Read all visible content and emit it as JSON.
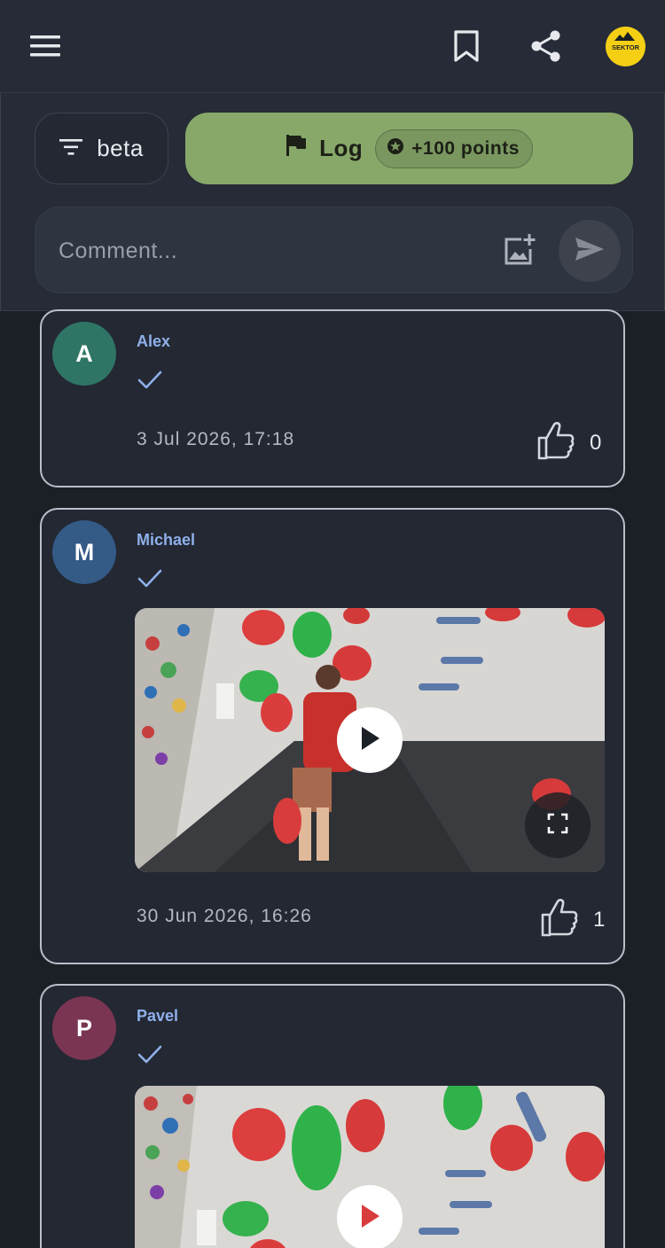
{
  "header": {
    "logo_text": "SEKTOR"
  },
  "actions": {
    "filter_label": "beta",
    "log_label": "Log",
    "points_label": "+100 points",
    "comment_placeholder": "Comment..."
  },
  "posts": [
    {
      "avatar_letter": "A",
      "avatar_color": "#2f7565",
      "username": "Alex",
      "timestamp": "3 Jul 2026, 17:18",
      "likes": "0",
      "has_video": false
    },
    {
      "avatar_letter": "M",
      "avatar_color": "#345a86",
      "username": "Michael",
      "timestamp": "30 Jun 2026, 16:26",
      "likes": "1",
      "has_video": true
    },
    {
      "avatar_letter": "P",
      "avatar_color": "#7a3552",
      "username": "Pavel",
      "has_video": true
    }
  ],
  "colors": {
    "background": "#1b1f26",
    "header": "#262b37",
    "log_button": "#88a86a",
    "username": "#8fb0ea",
    "check": "#8fb0ea"
  }
}
